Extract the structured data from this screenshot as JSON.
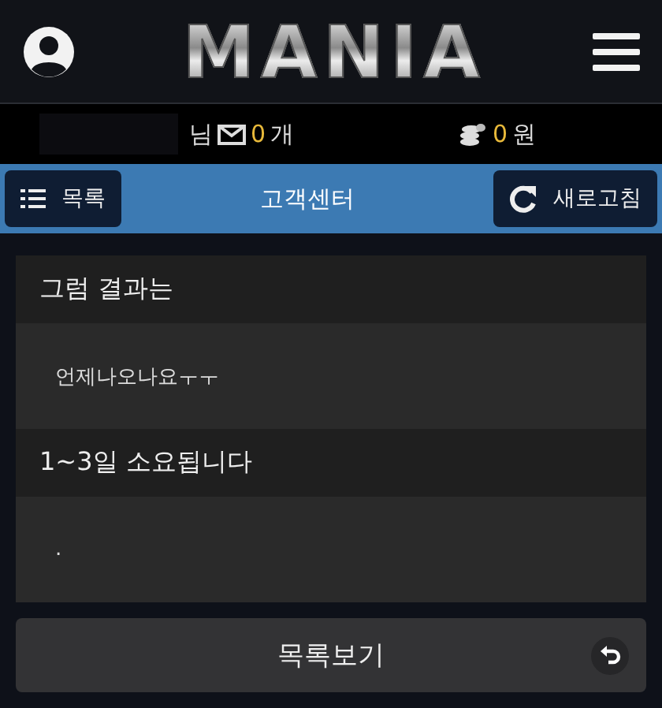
{
  "header": {
    "logo": "MANIA"
  },
  "info_bar": {
    "user_suffix": "님",
    "messages_count": "0",
    "messages_unit": "개",
    "points": "0",
    "points_unit": "원"
  },
  "nav_bar": {
    "list_button": "목록",
    "title": "고객센터",
    "refresh_button": "새로고침"
  },
  "posts": [
    {
      "title": "그럼 결과는",
      "body": "언제나오나요ㅜㅜ"
    },
    {
      "title": "1~3일 소요됩니다",
      "body": "."
    }
  ],
  "back_button": "목록보기"
}
